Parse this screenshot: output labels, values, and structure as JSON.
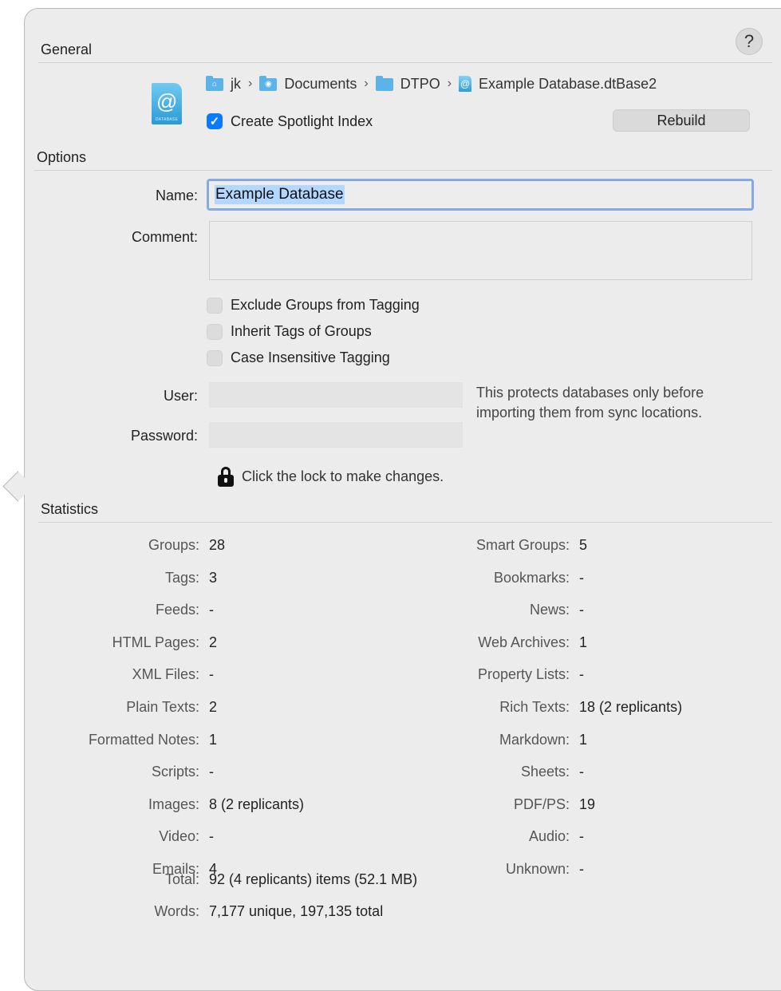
{
  "general": {
    "title": "General",
    "help_label": "?",
    "path": [
      "jk",
      "Documents",
      "DTPO",
      "Example Database.dtBase2"
    ],
    "path_separator": "›",
    "spotlight_label": "Create Spotlight Index",
    "spotlight_checked": true,
    "rebuild_label": "Rebuild",
    "db_icon_label": "DATABASE"
  },
  "options": {
    "title": "Options",
    "name_label": "Name:",
    "name_value": "Example Database",
    "comment_label": "Comment:",
    "comment_value": "",
    "checkboxes": [
      {
        "label": "Exclude Groups from Tagging",
        "checked": false
      },
      {
        "label": "Inherit Tags of Groups",
        "checked": false
      },
      {
        "label": "Case Insensitive Tagging",
        "checked": false
      }
    ],
    "user_label": "User:",
    "password_label": "Password:",
    "user_value": "",
    "password_value": "",
    "protect_note": "This protects databases only before importing them from sync locations.",
    "lock_label": "Click the lock to make changes."
  },
  "statistics": {
    "title": "Statistics",
    "left": [
      {
        "label": "Groups:",
        "value": "28"
      },
      {
        "label": "Tags:",
        "value": "3"
      },
      {
        "label": "Feeds:",
        "value": "-"
      },
      {
        "label": "HTML Pages:",
        "value": "2"
      },
      {
        "label": "XML Files:",
        "value": "-"
      },
      {
        "label": "Plain Texts:",
        "value": "2"
      },
      {
        "label": "Formatted Notes:",
        "value": "1"
      },
      {
        "label": "Scripts:",
        "value": "-"
      },
      {
        "label": "Images:",
        "value": "8 (2 replicants)"
      },
      {
        "label": "Video:",
        "value": "-"
      },
      {
        "label": "Emails:",
        "value": "4"
      }
    ],
    "right": [
      {
        "label": "Smart Groups:",
        "value": "5"
      },
      {
        "label": "Bookmarks:",
        "value": "-"
      },
      {
        "label": "News:",
        "value": "-"
      },
      {
        "label": "Web Archives:",
        "value": "1"
      },
      {
        "label": "Property Lists:",
        "value": "-"
      },
      {
        "label": "Rich Texts:",
        "value": "18 (2 replicants)"
      },
      {
        "label": "Markdown:",
        "value": "1"
      },
      {
        "label": "Sheets:",
        "value": "-"
      },
      {
        "label": "PDF/PS:",
        "value": "19"
      },
      {
        "label": "Audio:",
        "value": "-"
      },
      {
        "label": "Unknown:",
        "value": "-"
      }
    ],
    "total_label": "Total:",
    "total_value": "92 (4 replicants) items (52.1 MB)",
    "words_label": "Words:",
    "words_value": "7,177 unique, 197,135 total"
  },
  "colors": {
    "accent": "#0a7aff",
    "focus_ring": "#85a9e4",
    "selection": "#b3d7ff",
    "panel_bg": "#ececec"
  },
  "icons": [
    "help-icon",
    "database-icon",
    "home-folder-icon",
    "documents-folder-icon",
    "folder-icon",
    "database-file-icon",
    "checkmark-icon",
    "lock-icon"
  ]
}
